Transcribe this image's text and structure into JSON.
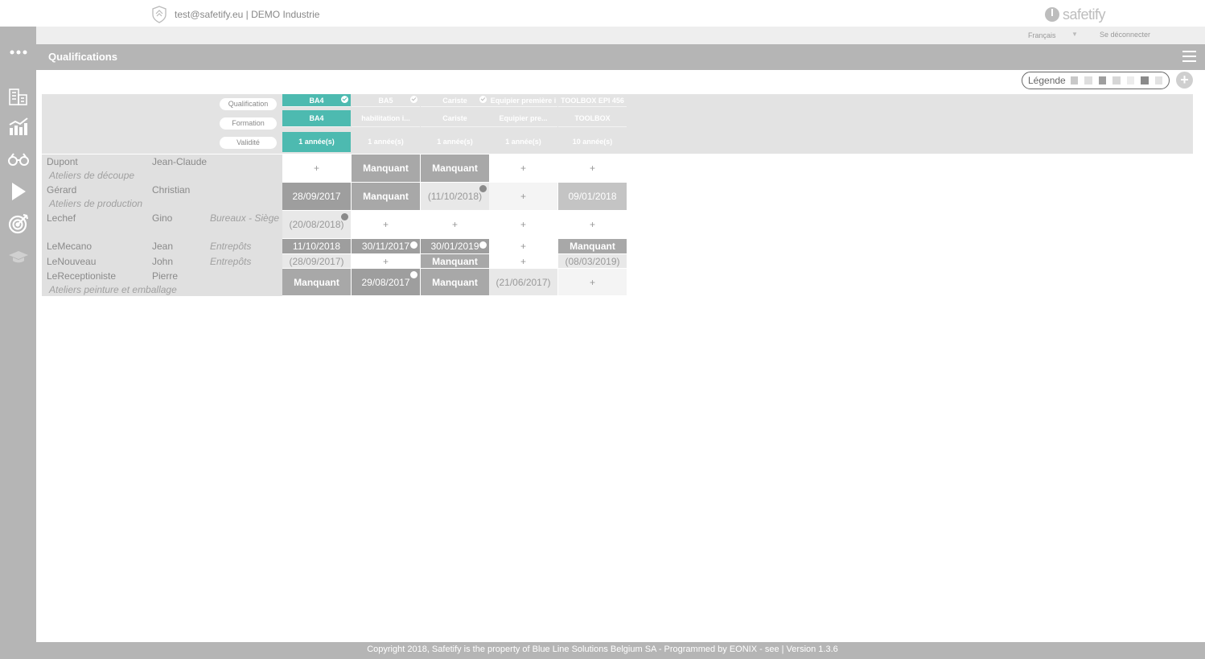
{
  "topbar": {
    "user_info": "test@safetify.eu | DEMO Industrie",
    "brand": "safetify"
  },
  "subbar": {
    "language": "Français",
    "logout": "Se déconnecter"
  },
  "page": {
    "title": "Qualifications"
  },
  "legend": {
    "label": "Légende",
    "colors": [
      "#c8c8c8",
      "#dedede",
      "#9e9e9e",
      "#d6d6d6",
      "#ececec",
      "#8a8a8a",
      "#e2e2e2"
    ]
  },
  "header_pills": {
    "qualification": "Qualification",
    "formation": "Formation",
    "validite": "Validité"
  },
  "columns": [
    {
      "qualification": "BA4",
      "formation": "BA4",
      "validite": "1 année(s)",
      "active": true
    },
    {
      "qualification": "BA5",
      "formation": "habilitation i...",
      "validite": "1 année(s)",
      "active": false
    },
    {
      "qualification": "Cariste",
      "formation": "Cariste",
      "validite": "1 année(s)",
      "active": false
    },
    {
      "qualification": "Equipier première i",
      "formation": "Equipier pre...",
      "validite": "1 année(s)",
      "active": false
    },
    {
      "qualification": "TOOLBOX EPI 456",
      "formation": "TOOLBOX",
      "validite": "10 année(s)",
      "active": false
    }
  ],
  "rows": [
    {
      "last": "Dupont",
      "first": "Jean-Claude",
      "site": "",
      "dept": "Ateliers de découpe",
      "cells": [
        "+",
        "Manquant",
        "Manquant",
        "+",
        "+"
      ]
    },
    {
      "last": "Gérard",
      "first": "Christian",
      "site": "",
      "dept": "Ateliers de production",
      "cells": [
        "28/09/2017",
        "Manquant",
        "(11/10/2018)",
        "+",
        "09/01/2018"
      ]
    },
    {
      "last": "Lechef",
      "first": "Gino",
      "site": "Bureaux - Siège",
      "dept": "",
      "cells": [
        "(20/08/2018)",
        "+",
        "+",
        "+",
        "+"
      ]
    },
    {
      "last": "LeMecano",
      "first": "Jean",
      "site": "Entrepôts",
      "dept": "",
      "cells": [
        "11/10/2018",
        "30/11/2017",
        "30/01/2019",
        "+",
        "Manquant"
      ]
    },
    {
      "last": "LeNouveau",
      "first": "John",
      "site": "Entrepôts",
      "dept": "",
      "cells": [
        "(28/09/2017)",
        "+",
        "Manquant",
        "+",
        "(08/03/2019)"
      ]
    },
    {
      "last": "LeReceptioniste",
      "first": "Pierre",
      "site": "",
      "dept": "Ateliers peinture et emballage",
      "cells": [
        "Manquant",
        "29/08/2017",
        "Manquant",
        "(21/06/2017)",
        "+"
      ]
    }
  ],
  "footer": {
    "text": "Copyright 2018, Safetify is the property of Blue Line Solutions Belgium SA - Programmed by EONIX - see | Version 1.3.6"
  },
  "nav_icons": [
    "more-icon",
    "buildings-icon",
    "chart-icon",
    "binoculars-icon",
    "play-icon",
    "target-icon",
    "graduation-cap-icon"
  ]
}
